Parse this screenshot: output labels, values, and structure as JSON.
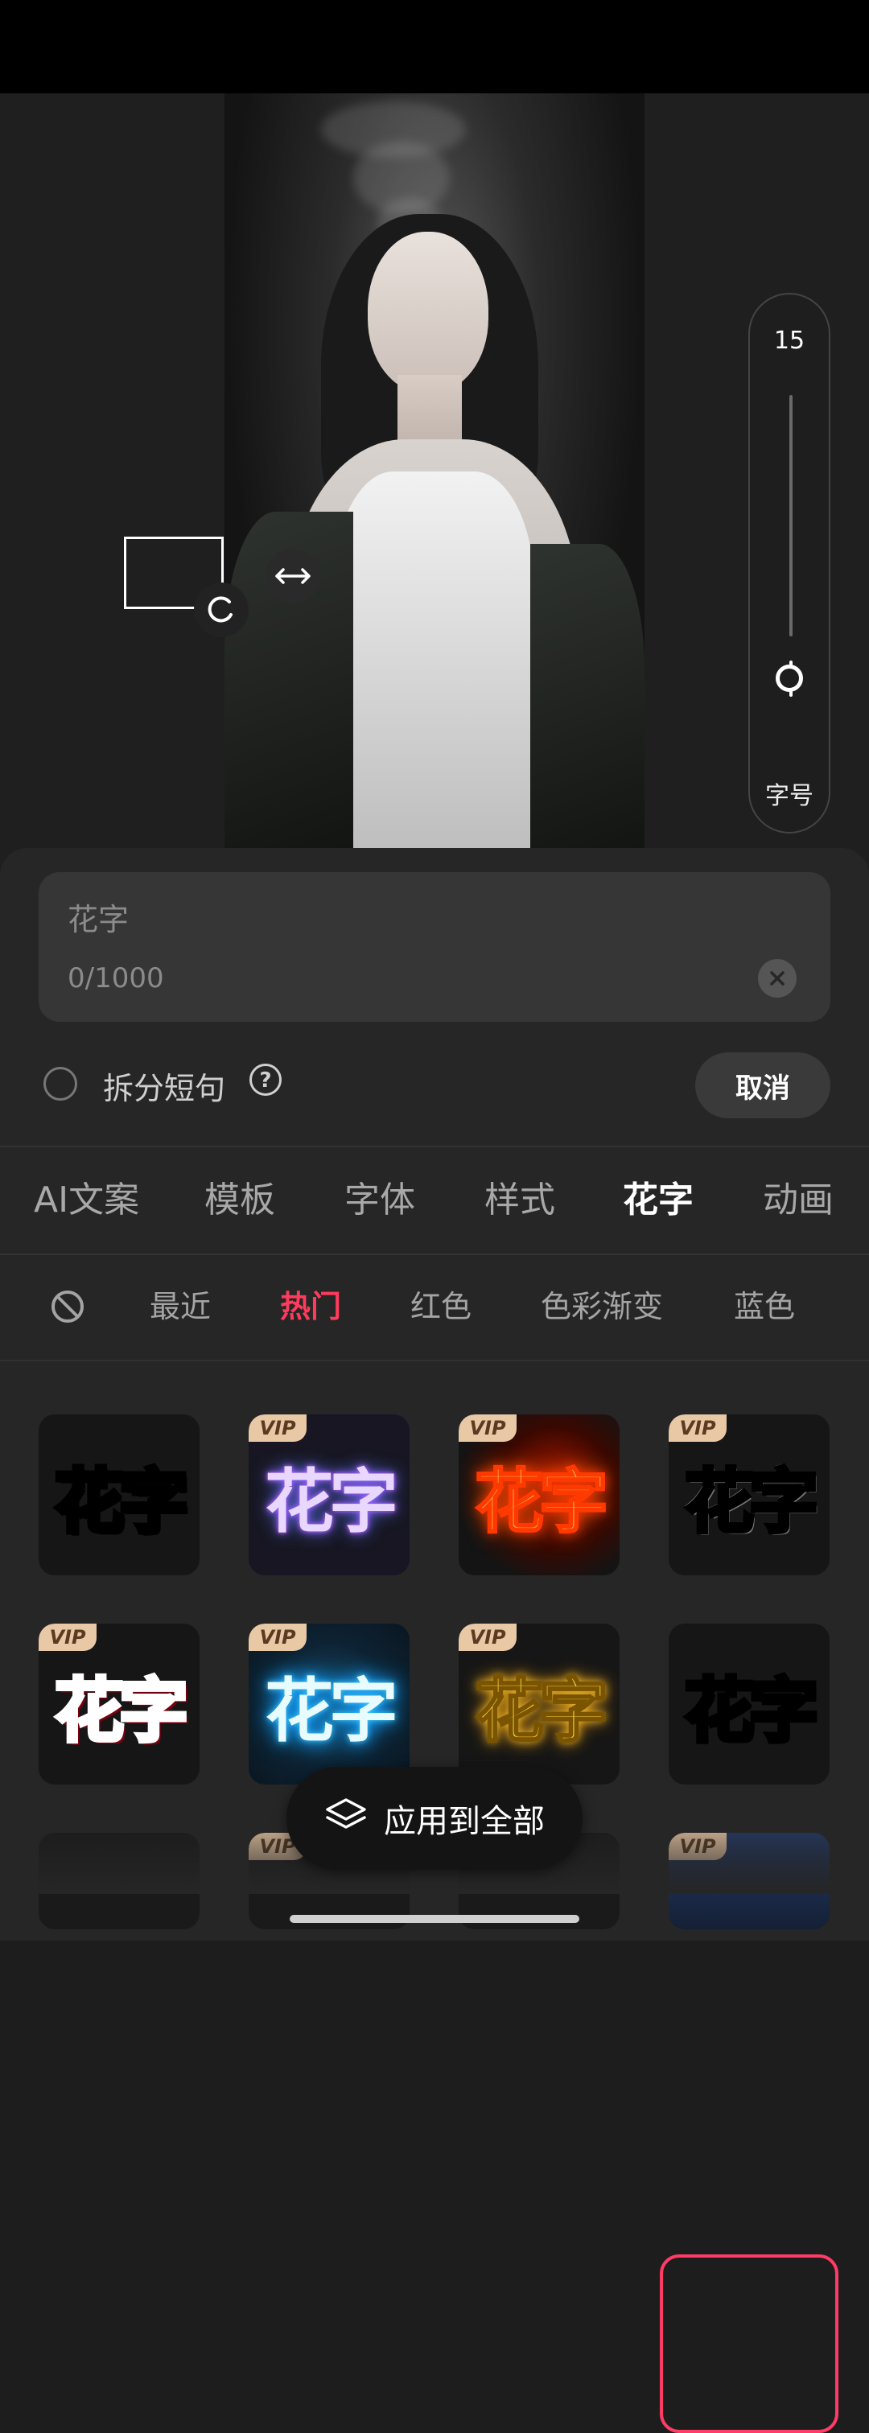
{
  "font_size_panel": {
    "value": "15",
    "label": "字号",
    "level": 0.15
  },
  "text_input": {
    "placeholder": "花字",
    "count": "0/1000"
  },
  "split_option": {
    "label": "拆分短句",
    "checked": false
  },
  "cancel_label": "取消",
  "main_tabs": [
    {
      "label": "AI文案"
    },
    {
      "label": "模板"
    },
    {
      "label": "字体"
    },
    {
      "label": "样式"
    },
    {
      "label": "花字"
    },
    {
      "label": "动画"
    }
  ],
  "active_main_tab": "花字",
  "sub_tabs": [
    {
      "label": "最近"
    },
    {
      "label": "热门"
    },
    {
      "label": "红色"
    },
    {
      "label": "色彩渐变"
    },
    {
      "label": "蓝色"
    }
  ],
  "active_sub_tab": "热门",
  "effects": [
    {
      "text": "花字",
      "vip": false,
      "style": "yellow-outline"
    },
    {
      "text": "花字",
      "vip": true,
      "badge": "VIP",
      "style": "purple-glow"
    },
    {
      "text": "花字",
      "vip": true,
      "badge": "VIP",
      "style": "fire"
    },
    {
      "text": "花字",
      "vip": true,
      "badge": "VIP",
      "style": "white-bold",
      "selected": true
    },
    {
      "text": "花字",
      "vip": true,
      "badge": "VIP",
      "style": "red-white-outline"
    },
    {
      "text": "花字",
      "vip": true,
      "badge": "VIP",
      "style": "blue-electric"
    },
    {
      "text": "花字",
      "vip": true,
      "badge": "VIP",
      "style": "gold-lightning"
    },
    {
      "text": "花字",
      "vip": false,
      "style": "white-black-outline"
    }
  ],
  "apply_all_label": "应用到全部",
  "colors": {
    "accent": "#ff3b5c",
    "sheet_bg": "#262626",
    "vip_badge": "#e9c8a5"
  }
}
